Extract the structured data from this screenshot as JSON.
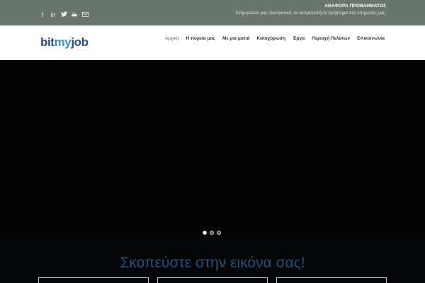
{
  "topbar": {
    "social_icons": [
      "facebook-icon",
      "linkedin-icon",
      "twitter-icon",
      "youtube-icon",
      "mail-icon"
    ],
    "social_glyphs": [
      "f",
      "in",
      "🐦",
      "▶",
      "✉"
    ],
    "report_title": "ΑΝΑΦΟΡΑ ΠΡΟΒΛΗΜΑΤΟΣ",
    "report_text": "Ενημερώστε μας ηλεκτρονικά, αν αντιμετωπίζετε πρόβλημα στις υπηρεσίες μας."
  },
  "logo": {
    "part1": "bit",
    "part2": "my",
    "part3": "job"
  },
  "menu": {
    "items": [
      {
        "label": "Αρχική"
      },
      {
        "label": "Η πορεία μας"
      },
      {
        "label": "Με μια ματιά"
      },
      {
        "label": "Κατοχύρωση"
      },
      {
        "label": "Έργα"
      },
      {
        "label": "Περιοχή Πελατών"
      },
      {
        "label": "Επικοινωνία"
      }
    ]
  },
  "hero": {
    "active_slide": 1,
    "slide_count": 3
  },
  "section": {
    "slogan": "Σκοπεύστε στην εικόνα σας!"
  },
  "colors": {
    "topbar": "#6b7570",
    "brand_dark": "#2a4f7a",
    "brand_light": "#3b8fc4",
    "slogan": "#21527c"
  }
}
